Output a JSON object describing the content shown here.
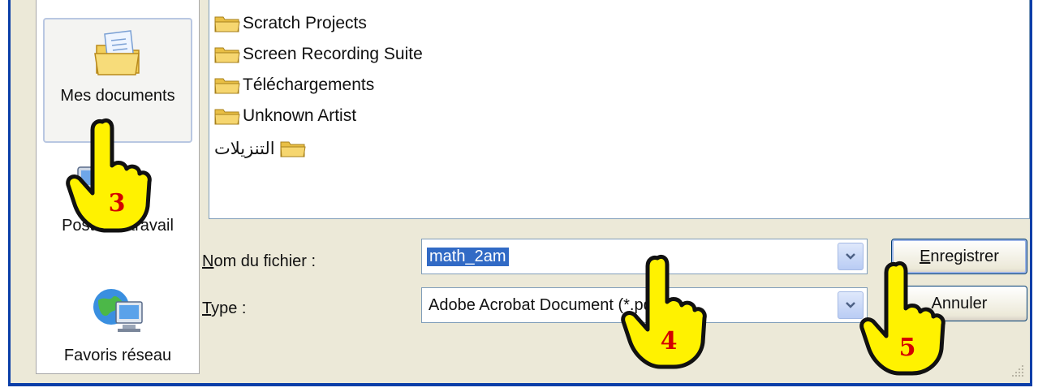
{
  "places_bar": {
    "items": [
      {
        "label": "Mes documents",
        "icon": "my-documents-icon",
        "selected": true
      },
      {
        "label": "Poste de travail",
        "icon": "my-computer-icon",
        "selected": false
      },
      {
        "label": "Favoris réseau",
        "icon": "network-places-icon",
        "selected": false
      }
    ]
  },
  "file_list": {
    "folders": [
      {
        "name": "Scratch Projects"
      },
      {
        "name": "Screen Recording Suite"
      },
      {
        "name": "Téléchargements"
      },
      {
        "name": "Unknown Artist"
      },
      {
        "name": "التنزيلات"
      }
    ]
  },
  "form": {
    "filename_label_first": "N",
    "filename_label_rest": "om du fichier :",
    "filename_value": "math_2am",
    "type_label_first": "T",
    "type_label_rest": "ype :",
    "type_value": "Adobe Acrobat Document (*.pdf)"
  },
  "buttons": {
    "save_first": "E",
    "save_rest": "nregistrer",
    "cancel_label": "Annuler"
  },
  "annotations": [
    {
      "number": "3",
      "target": "Mes documents"
    },
    {
      "number": "4",
      "target": "Nom du fichier"
    },
    {
      "number": "5",
      "target": "Enregistrer"
    }
  ],
  "colors": {
    "dialog_bg": "#ece9d8",
    "frame_border": "#0a3ea8",
    "selection": "#316ac5",
    "hand_fill": "#fff200",
    "annotation_number": "#d40000"
  }
}
